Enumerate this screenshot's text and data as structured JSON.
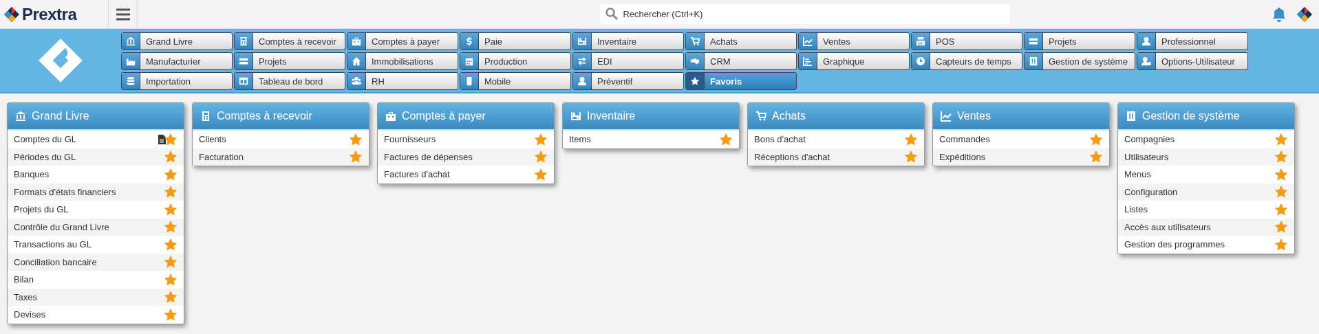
{
  "header": {
    "brand": "Prextra",
    "search": {
      "placeholder": "Rechercher (Ctrl+K)"
    }
  },
  "modules": [
    {
      "label": "Grand Livre",
      "selected": false
    },
    {
      "label": "Comptes à recevoir",
      "selected": false
    },
    {
      "label": "Comptes à payer",
      "selected": false
    },
    {
      "label": "Paie",
      "selected": false
    },
    {
      "label": "Inventaire",
      "selected": false
    },
    {
      "label": "Achats",
      "selected": false
    },
    {
      "label": "Ventes",
      "selected": false
    },
    {
      "label": "POS",
      "selected": false
    },
    {
      "label": "Projets",
      "selected": false
    },
    {
      "label": "Professionnel",
      "selected": false
    },
    {
      "label": "Manufacturier",
      "selected": false
    },
    {
      "label": "Projets",
      "selected": false
    },
    {
      "label": "Immobilisations",
      "selected": false
    },
    {
      "label": "Production",
      "selected": false
    },
    {
      "label": "EDI",
      "selected": false
    },
    {
      "label": "CRM",
      "selected": false
    },
    {
      "label": "Graphique",
      "selected": false
    },
    {
      "label": "Capteurs de temps",
      "selected": false
    },
    {
      "label": "Gestion de système",
      "selected": false
    },
    {
      "label": "Options-Utilisateur",
      "selected": false
    },
    {
      "label": "Importation",
      "selected": false
    },
    {
      "label": "Tableau de bord",
      "selected": false
    },
    {
      "label": "RH",
      "selected": false
    },
    {
      "label": "Mobile",
      "selected": false
    },
    {
      "label": "Préventif",
      "selected": false
    },
    {
      "label": "Favoris",
      "selected": true
    }
  ],
  "panels": [
    {
      "title": "Grand Livre",
      "items": [
        {
          "label": "Comptes du GL",
          "favorite": true,
          "report": true
        },
        {
          "label": "Périodes du GL",
          "favorite": true,
          "report": false
        },
        {
          "label": "Banques",
          "favorite": true,
          "report": false
        },
        {
          "label": "Formats d'états financiers",
          "favorite": true,
          "report": false
        },
        {
          "label": "Projets du GL",
          "favorite": true,
          "report": false
        },
        {
          "label": "Contrôle du Grand Livre",
          "favorite": true,
          "report": false
        },
        {
          "label": "Transactions au GL",
          "favorite": true,
          "report": false
        },
        {
          "label": "Conciliation bancaire",
          "favorite": true,
          "report": false
        },
        {
          "label": "Bilan",
          "favorite": true,
          "report": false
        },
        {
          "label": "Taxes",
          "favorite": true,
          "report": false
        },
        {
          "label": "Devises",
          "favorite": true,
          "report": false
        }
      ]
    },
    {
      "title": "Comptes à recevoir",
      "items": [
        {
          "label": "Clients",
          "favorite": true,
          "report": false
        },
        {
          "label": "Facturation",
          "favorite": true,
          "report": false
        }
      ]
    },
    {
      "title": "Comptes à payer",
      "items": [
        {
          "label": "Fournisseurs",
          "favorite": true,
          "report": false
        },
        {
          "label": "Factures de dépenses",
          "favorite": true,
          "report": false
        },
        {
          "label": "Factures d'achat",
          "favorite": true,
          "report": false
        }
      ]
    },
    {
      "title": "Inventaire",
      "items": [
        {
          "label": "Items",
          "favorite": true,
          "report": false
        }
      ]
    },
    {
      "title": "Achats",
      "items": [
        {
          "label": "Bons d'achat",
          "favorite": true,
          "report": false
        },
        {
          "label": "Réceptions d'achat",
          "favorite": true,
          "report": false
        }
      ]
    },
    {
      "title": "Ventes",
      "items": [
        {
          "label": "Commandes",
          "favorite": true,
          "report": false
        },
        {
          "label": "Expéditions",
          "favorite": true,
          "report": false
        }
      ]
    },
    {
      "title": "Gestion de système",
      "items": [
        {
          "label": "Compagnies",
          "favorite": true,
          "report": false
        },
        {
          "label": "Utilisateurs",
          "favorite": true,
          "report": false
        },
        {
          "label": "Menus",
          "favorite": true,
          "report": false
        },
        {
          "label": "Configuration",
          "favorite": true,
          "report": false
        },
        {
          "label": "Listes",
          "favorite": true,
          "report": false
        },
        {
          "label": "Accès aux utilisateurs",
          "favorite": true,
          "report": false
        },
        {
          "label": "Gestion des programmes",
          "favorite": true,
          "report": false
        }
      ]
    }
  ]
}
